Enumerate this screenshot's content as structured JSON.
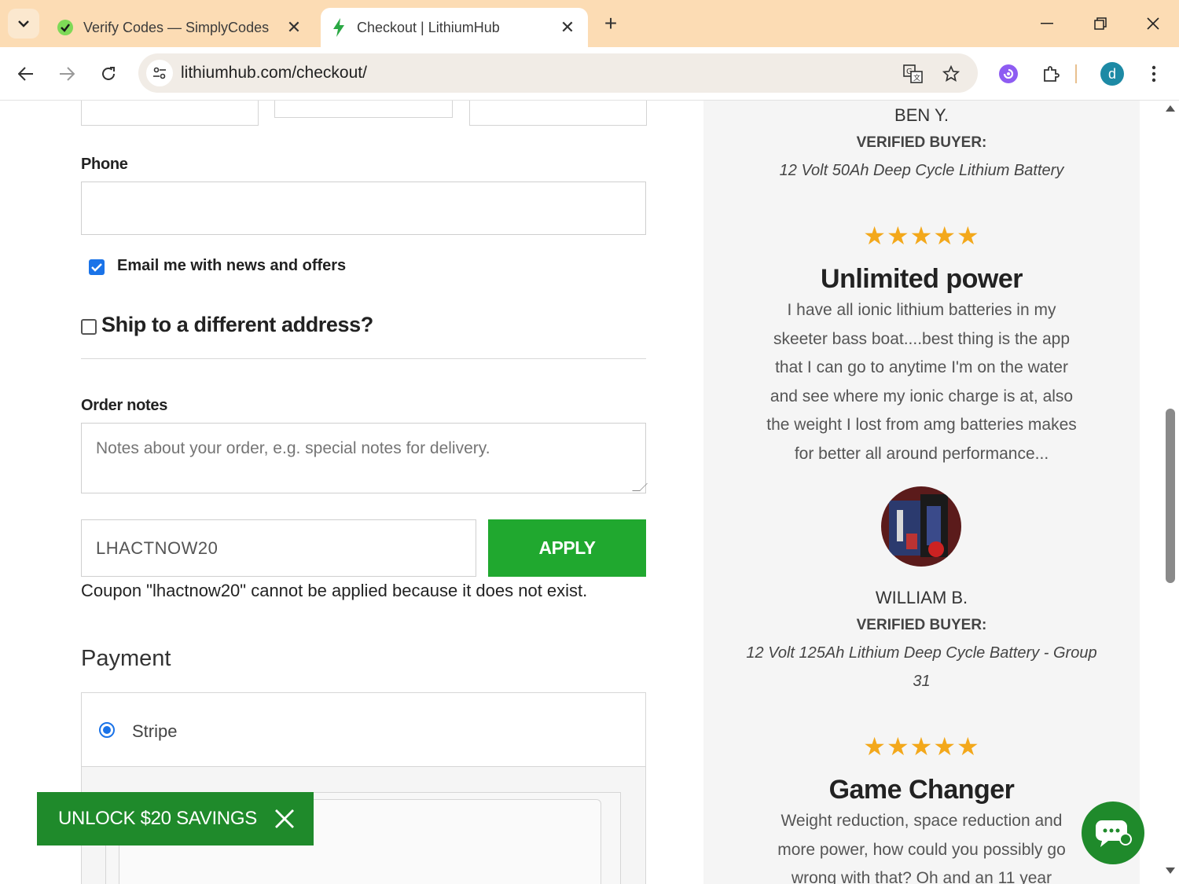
{
  "browser": {
    "tabs": [
      {
        "title": "Verify Codes — SimplyCodes",
        "favicon": "simplycodes-icon",
        "active": false
      },
      {
        "title": "Checkout | LithiumHub",
        "favicon": "lightning-icon",
        "active": true
      }
    ],
    "url": "lithiumhub.com/checkout/",
    "profile_initial": "d"
  },
  "form": {
    "phone_label": "Phone",
    "email_opt_in_label": "Email me with news and offers",
    "email_opt_in_checked": true,
    "ship_different_label": "Ship to a different address?",
    "ship_different_checked": false,
    "order_notes_label": "Order notes",
    "order_notes_placeholder": "Notes about your order, e.g. special notes for delivery.",
    "coupon_value": "LHACTNOW20",
    "apply_label": "APPLY",
    "coupon_error": "Coupon \"lhactnow20\" cannot be applied because it does not exist."
  },
  "payment": {
    "heading": "Payment",
    "methods": [
      {
        "label": "Stripe",
        "selected": true
      }
    ]
  },
  "promo": {
    "unlock_label": "UNLOCK $20 SAVINGS"
  },
  "reviews": [
    {
      "name": "BEN Y.",
      "verified": "VERIFIED BUYER:",
      "product": "12 Volt 50Ah Deep Cycle Lithium Battery"
    },
    {
      "stars": "★★★★★",
      "rating": 5,
      "title": "Unlimited power",
      "body_lines": [
        "I have all ionic lithium batteries in my",
        "skeeter bass boat....best thing is the app",
        "that I can go to anytime I'm on the water",
        "and see where my ionic charge is at, also",
        "the weight I lost from amg batteries makes",
        "for better all around performance..."
      ],
      "name": "WILLIAM B.",
      "verified": "VERIFIED BUYER:",
      "product_lines": [
        "12 Volt 125Ah Lithium Deep Cycle Battery - Group",
        "31"
      ]
    },
    {
      "stars": "★★★★★",
      "rating": 5,
      "title": "Game Changer",
      "body_lines": [
        "Weight reduction, space reduction and",
        "more power, how could you possibly go",
        "wrong with that? Oh and an 11 year"
      ]
    }
  ],
  "colors": {
    "tabbar": "#fcdcb4",
    "accent_green": "#20a82f",
    "promo_green": "#1f8a2b",
    "star": "#f3a81b",
    "checkbox_blue": "#1a73e8"
  }
}
